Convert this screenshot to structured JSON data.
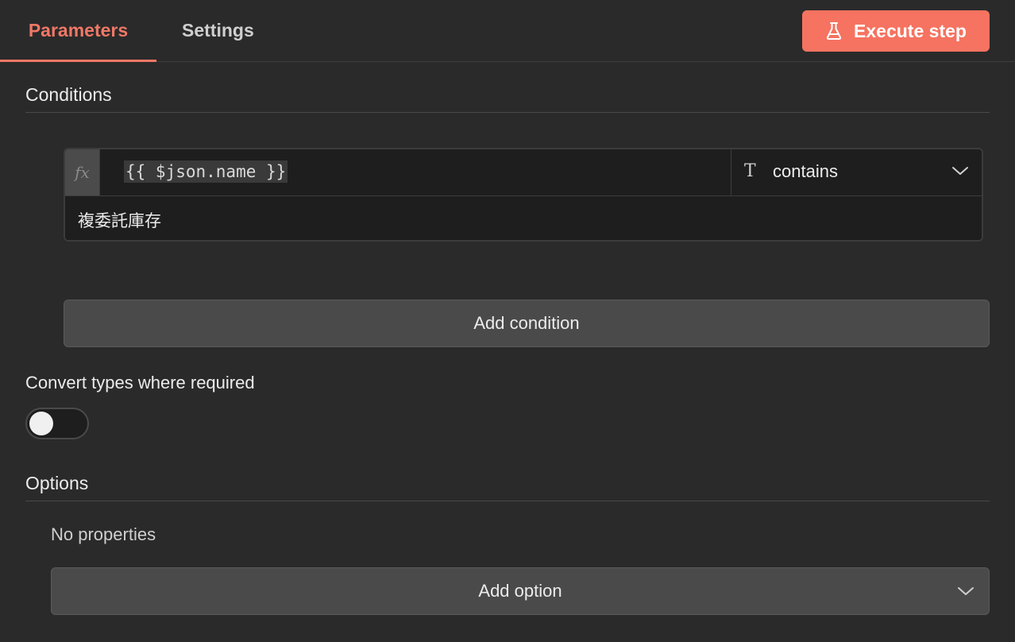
{
  "header": {
    "tabs": [
      {
        "label": "Parameters",
        "active": true
      },
      {
        "label": "Settings",
        "active": false
      }
    ],
    "execute_label": "Execute step",
    "execute_icon": "flask-icon"
  },
  "colors": {
    "accent": "#f07866",
    "button_primary": "#f57360",
    "background": "#2a2a2a",
    "input_background": "#1e1e1e"
  },
  "conditions": {
    "title": "Conditions",
    "items": [
      {
        "fx_label": "fx",
        "left_value": "{{ $json.name }}",
        "operator_type_icon": "T",
        "operator": "contains",
        "right_value": "複委託庫存"
      }
    ],
    "add_label": "Add condition"
  },
  "convert_types": {
    "label": "Convert types where required",
    "enabled": false
  },
  "options": {
    "title": "Options",
    "empty_text": "No properties",
    "add_label": "Add option"
  }
}
